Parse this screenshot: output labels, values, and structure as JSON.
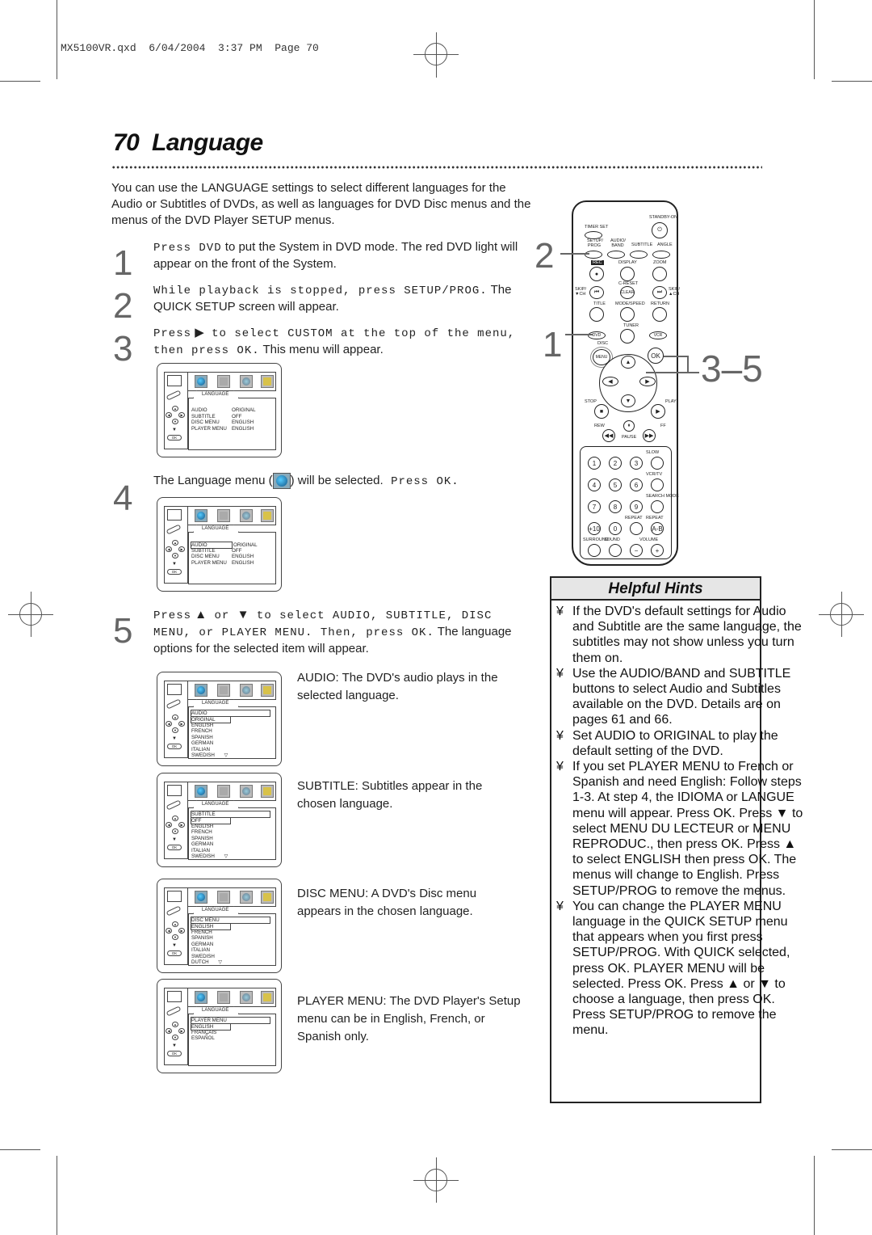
{
  "slug": "MX5100VR.qxd  6/04/2004  3:37 PM  Page 70",
  "page": {
    "number": "70",
    "title": "Language"
  },
  "intro": "You can use the LANGUAGE settings to select different languages for the Audio or Subtitles of DVDs, as well as languages for DVD Disc menus and the menus of the DVD Player SETUP menus.",
  "steps": [
    {
      "num": "1",
      "mono": "Press DVD",
      "text": " to put the System in DVD mode. The red DVD light will appear on the front of the System."
    },
    {
      "num": "2",
      "mono": "While playback is stopped, press SETUP/PROG.",
      "text": " The QUICK SETUP screen will appear."
    },
    {
      "num": "3",
      "mono_a": "Press",
      "arrow": "▶",
      "mono_b": " to select CUSTOM at the top of the menu, then press OK.",
      "text": " This menu will appear."
    },
    {
      "num": "4",
      "text_a": "The Language menu (",
      "text_b": ")  will be selected.",
      "mono": " Press OK."
    },
    {
      "num": "5",
      "mono_a": "Press",
      "up": "▲",
      "mono_or": " or ",
      "down": "▼",
      "mono_b": " to select AUDIO, SUBTITLE, DISC MENU, or PLAYER MENU. Then, press OK.",
      "text": " The language options for the selected item will appear."
    }
  ],
  "osd": {
    "tab": "LANGUAGE",
    "ok": "OK",
    "main_rows": [
      {
        "label": "AUDIO",
        "value": "ORIGINAL"
      },
      {
        "label": "SUBTITLE",
        "value": "OFF"
      },
      {
        "label": "DISC MENU",
        "value": "ENGLISH"
      },
      {
        "label": "PLAYER MENU",
        "value": "ENGLISH"
      }
    ],
    "audio": {
      "header": "AUDIO",
      "options": [
        "ORIGINAL",
        "ENGLISH",
        "FRENCH",
        "SPANISH",
        "GERMAN",
        "ITALIAN",
        "SWEDISH"
      ]
    },
    "subtitle": {
      "header": "SUBTITLE",
      "options": [
        "OFF",
        "ENGLISH",
        "FRENCH",
        "SPANISH",
        "GERMAN",
        "ITALIAN",
        "SWEDISH"
      ]
    },
    "disc_menu": {
      "header": "DISC MENU",
      "options": [
        "ENGLISH",
        "FRENCH",
        "SPANISH",
        "GERMAN",
        "ITALIAN",
        "SWEDISH",
        "DUTCH"
      ]
    },
    "player_menu": {
      "header": "PLAYER MENU",
      "options": [
        "ENGLISH",
        "FRANÇAIS",
        "ESPAÑOL"
      ]
    },
    "more_arrow": "▽"
  },
  "descriptions": {
    "audio": "AUDIO: The DVD's audio plays in the selected language.",
    "subtitle": "SUBTITLE: Subtitles appear in the chosen language.",
    "disc_menu": "DISC MENU: A DVD's Disc menu appears in the chosen language.",
    "player_menu": "PLAYER MENU: The DVD Player's Setup menu can be in English, French, or Spanish only."
  },
  "remote": {
    "callouts": {
      "step2": "2",
      "step1": "1",
      "step35": "3–5"
    },
    "labels": {
      "standby": "STANDBY-ON",
      "timer": "TIMER SET",
      "setup": "SETUP/ PROG",
      "audio": "AUDIO/ BAND",
      "subtitle": "SUBTITLE",
      "angle": "ANGLE",
      "rec": "REC",
      "display": "DISPLAY",
      "zoom": "ZOOM",
      "creset": "C-RESET",
      "clear": "CLEAR",
      "skip_l": "SKIP/ ▼CH",
      "skip_r": "SKIP/ ▲CH",
      "title": "TITLE",
      "mode": "MODE/SPEED",
      "return": "RETURN",
      "tuner": "TUNER",
      "dvd": "DVD",
      "vcr": "VCR",
      "disc": "DISC",
      "menu": "MENU",
      "ok": "OK",
      "stop": "STOP",
      "play": "PLAY",
      "rew": "REW",
      "ff": "FF",
      "pause": "PAUSE",
      "slow": "SLOW",
      "vcrtv": "VCR/TV",
      "search": "SEARCH MODE",
      "repeat": "REPEAT",
      "repeat_ab": "REPEAT",
      "ab": "A-B",
      "plus10": "+10",
      "surround": "SURROUND",
      "sound": "SOUND",
      "volume": "VOLUME",
      "minus": "−",
      "plus": "+"
    },
    "digits": [
      "1",
      "2",
      "3",
      "4",
      "5",
      "6",
      "7",
      "8",
      "9",
      "0"
    ]
  },
  "hints": {
    "title": "Helpful Hints",
    "bullet": "¥",
    "items": [
      "If the DVD's default settings for Audio and Subtitle are the same language, the subtitles may not show unless you turn them on.",
      "Use the AUDIO/BAND and SUBTITLE buttons to select Audio and Subtitles available on the DVD. Details are on pages 61 and 66.",
      "Set AUDIO to ORIGINAL to play the default setting of the DVD.",
      "If you set PLAYER MENU to French or Spanish and need English: Follow steps 1-3. At step 4, the IDIOMA or LANGUE menu will appear. Press OK. Press ▼ to select MENU DU LECTEUR or MENU REPRODUC., then press OK. Press ▲ to select ENGLISH then press OK. The menus will change to English. Press SETUP/PROG to remove the menus.",
      "You can change the PLAYER MENU language in the QUICK SETUP menu that appears when you first press SETUP/PROG. With QUICK selected, press OK. PLAYER MENU will be selected. Press OK. Press ▲ or ▼ to choose a language, then press OK. Press SETUP/PROG to remove the menu."
    ]
  }
}
